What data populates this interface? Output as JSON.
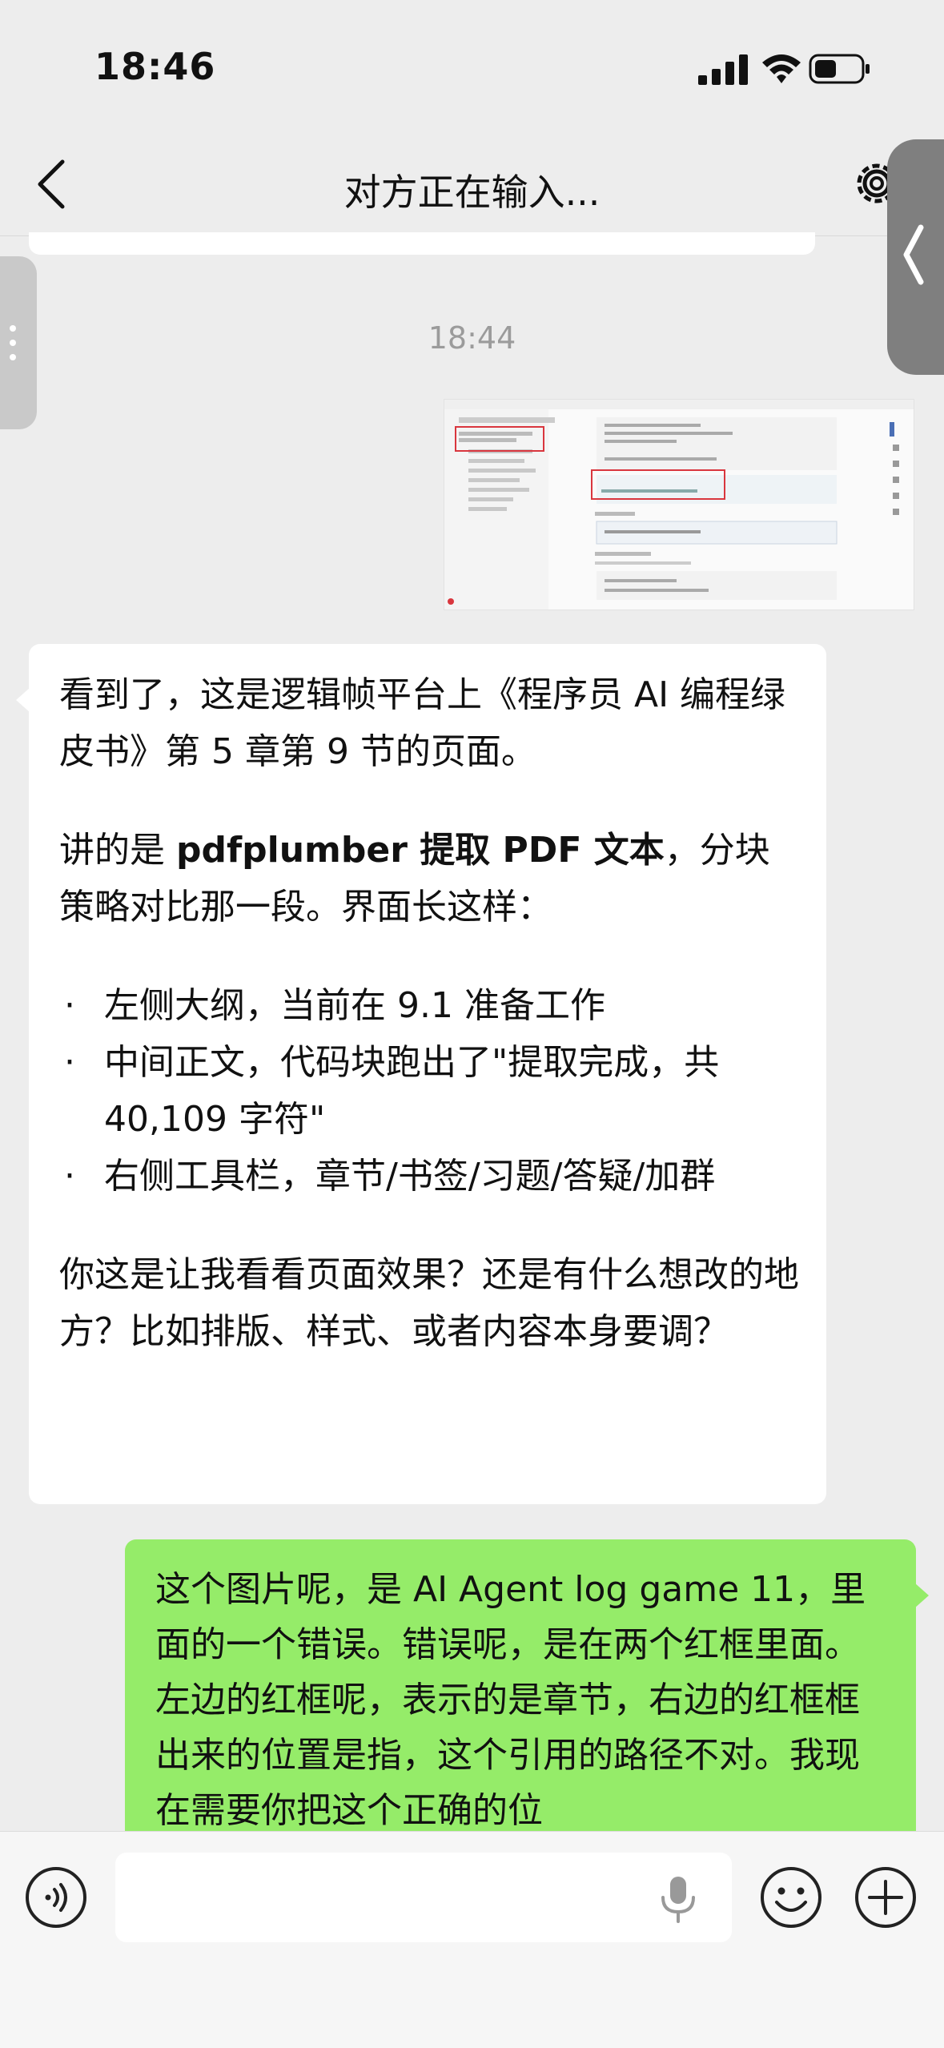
{
  "status_bar": {
    "time": "18:46"
  },
  "nav": {
    "title": "对方正在输入..."
  },
  "timestamp": "18:44",
  "incoming": {
    "p1": "看到了，这是逻辑帧平台上《程序员 AI 编程绿皮书》第 5 章第 9 节的页面。",
    "p2_before": "讲的是 ",
    "p2_bold": "pdfplumber 提取 PDF 文本",
    "p2_after": "，分块策略对比那一段。界面长这样：",
    "bullets": [
      "左侧大纲，当前在 9.1 准备工作",
      "中间正文，代码块跑出了\"提取完成，共 40,109 字符\"",
      "右侧工具栏，章节/书签/习题/答疑/加群"
    ],
    "p3": "你这是让我看看页面效果？还是有什么想改的地方？比如排版、样式、或者内容本身要调？"
  },
  "outgoing": {
    "text": "这个图片呢，是 AI Agent log game 11，里面的一个错误。错误呢，是在两个红框里面。左边的红框呢，表示的是章节，右边的红框框出来的位置是指，这个引用的路径不对。我现在需要你把这个正确的位"
  },
  "input": {
    "value": "",
    "placeholder": ""
  },
  "colors": {
    "bubble_out": "#95ec69",
    "bubble_in": "#ffffff",
    "background": "#ededed",
    "highlight_box": "#d9363e"
  }
}
